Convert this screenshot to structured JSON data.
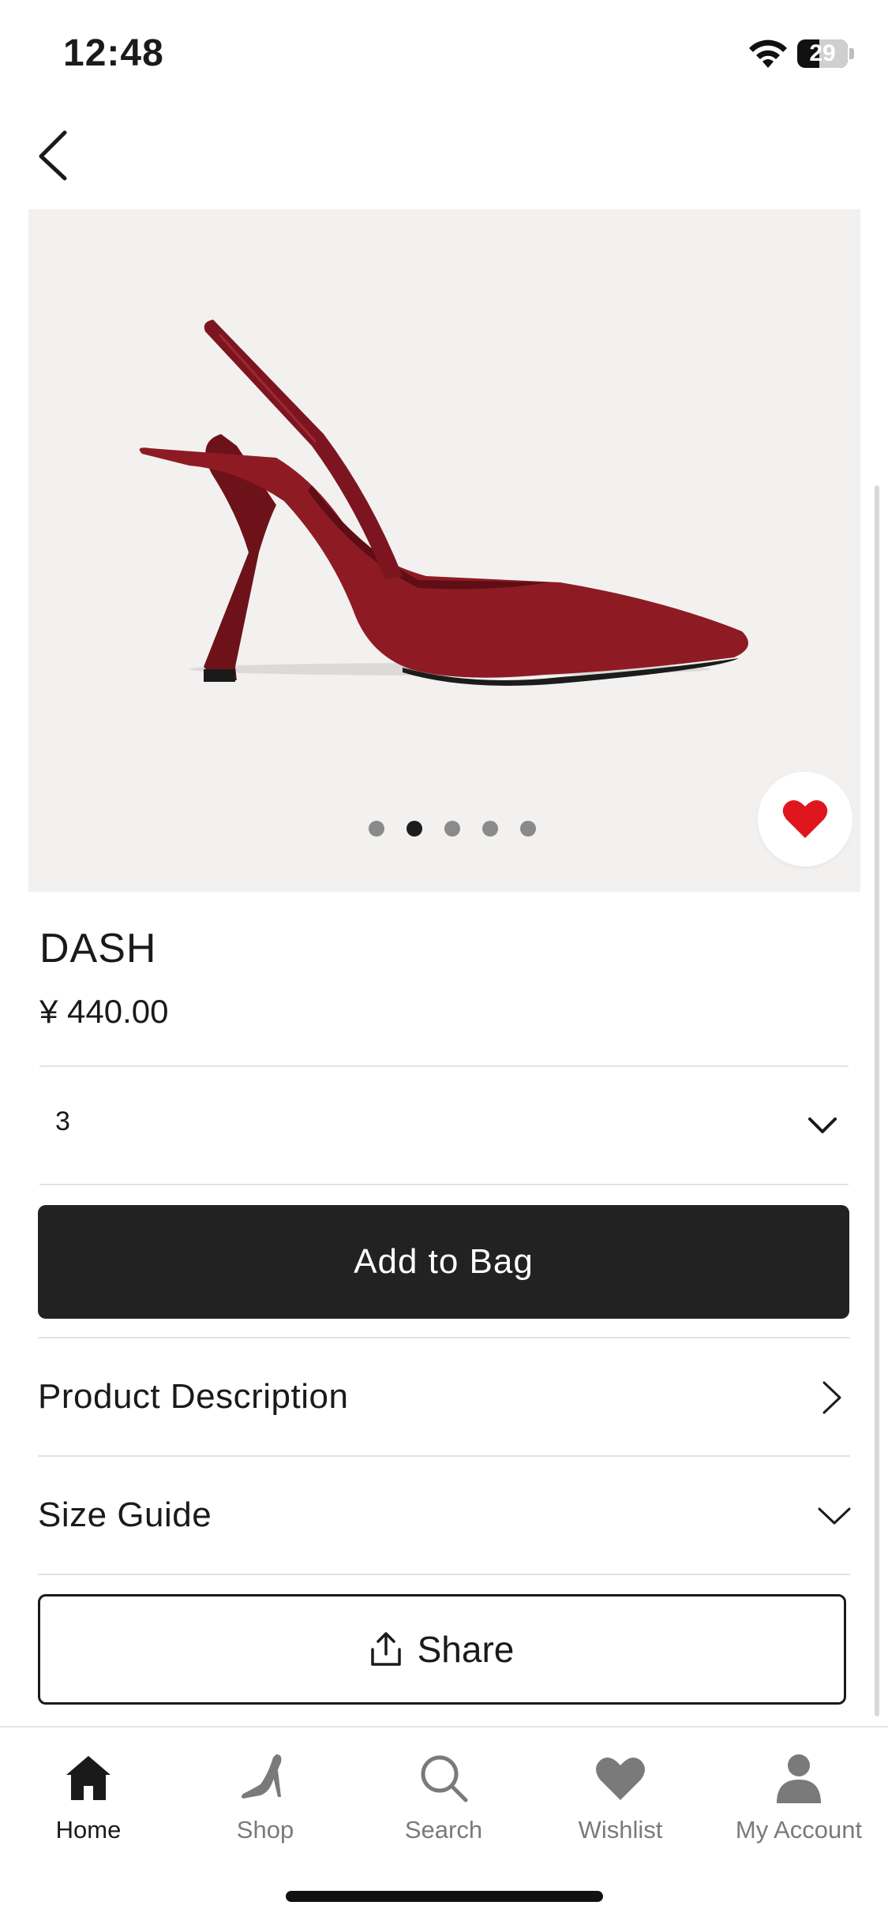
{
  "status_bar": {
    "time": "12:48",
    "battery": "29"
  },
  "product": {
    "name": "DASH",
    "price": "¥ 440.00",
    "image_count": 5,
    "active_image_index": 1,
    "wishlisted": true,
    "image_description_color": "#8e1b23"
  },
  "size_select": {
    "value": "3"
  },
  "actions": {
    "add_to_bag": "Add to Bag",
    "product_description": "Product Description",
    "size_guide": "Size Guide",
    "share": "Share"
  },
  "tabs": [
    {
      "label": "Home",
      "icon": "home-icon",
      "active": true
    },
    {
      "label": "Shop",
      "icon": "heel-shoe-icon",
      "active": false
    },
    {
      "label": "Search",
      "icon": "search-icon",
      "active": false
    },
    {
      "label": "Wishlist",
      "icon": "heart-icon",
      "active": false
    },
    {
      "label": "My Account",
      "icon": "person-icon",
      "active": false
    }
  ],
  "colors": {
    "accent_heart": "#e0161f",
    "button_dark": "#222222"
  }
}
